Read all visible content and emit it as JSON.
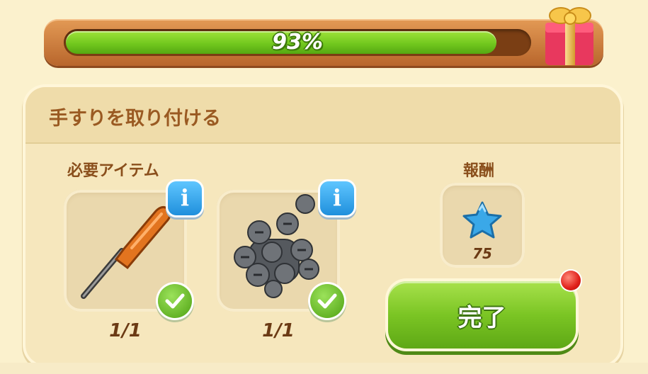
{
  "progress": {
    "label": "93%",
    "fraction": 0.93
  },
  "task": {
    "title": "手すりを取り付ける"
  },
  "required": {
    "label": "必要アイテム",
    "items": [
      {
        "icon": "screwdriver-icon",
        "count": "1/1",
        "info": "i"
      },
      {
        "icon": "screws-icon",
        "count": "1/1",
        "info": "i"
      }
    ]
  },
  "reward": {
    "label": "報酬",
    "icon": "blue-star-icon",
    "amount": "75"
  },
  "complete_button": {
    "label": "完了"
  },
  "colors": {
    "progress_fill": "#72c81e",
    "panel": "#f6e7bd",
    "title_text": "#9a5a22",
    "button_green": "#7bc524",
    "info_blue": "#1f8fdc",
    "notification_red": "#e0201a"
  }
}
